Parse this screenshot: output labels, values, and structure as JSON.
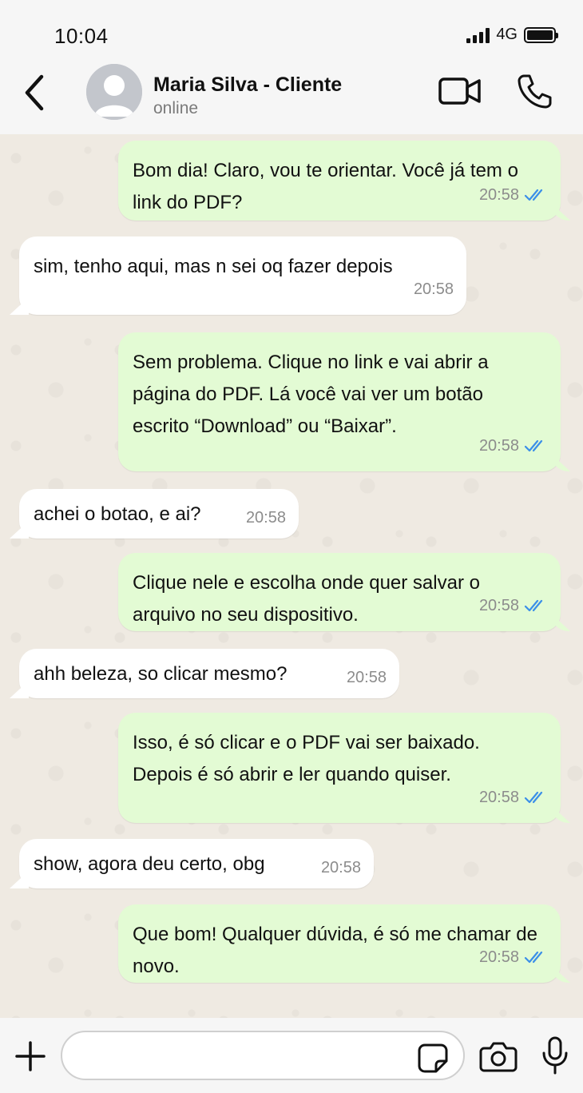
{
  "status_bar": {
    "time": "10:04",
    "network": "4G",
    "battery_level": 1.0
  },
  "header": {
    "contact_name": "Maria Silva - Cliente",
    "contact_status": "online"
  },
  "colors": {
    "outgoing_bubble": "#e3fbd4",
    "incoming_bubble": "#ffffff",
    "read_ticks": "#3b8fe8",
    "chat_background": "#efeae2"
  },
  "messages": [
    {
      "direction": "outgoing",
      "text": "Bom dia! Claro, vou te orientar. Você já tem o link do PDF?",
      "time": "20:58",
      "status": "read"
    },
    {
      "direction": "incoming",
      "text": "sim, tenho aqui, mas n sei oq fazer depois",
      "time": "20:58"
    },
    {
      "direction": "outgoing",
      "text": "Sem problema. Clique no link e vai abrir a página do PDF. Lá você vai ver um botão escrito “Download” ou “Baixar”.",
      "time": "20:58",
      "status": "read"
    },
    {
      "direction": "incoming",
      "text": "achei o botao, e ai?",
      "time": "20:58"
    },
    {
      "direction": "outgoing",
      "text": "Clique nele e escolha onde quer salvar o arquivo no seu dispositivo.",
      "time": "20:58",
      "status": "read"
    },
    {
      "direction": "incoming",
      "text": "ahh beleza, so clicar mesmo?",
      "time": "20:58"
    },
    {
      "direction": "outgoing",
      "text": "Isso, é só clicar e o PDF vai ser baixado. Depois é só abrir e ler quando quiser.",
      "time": "20:58",
      "status": "read"
    },
    {
      "direction": "incoming",
      "text": "show, agora deu certo, obg",
      "time": "20:58"
    },
    {
      "direction": "outgoing",
      "text": "Que bom! Qualquer dúvida, é só me chamar de novo.",
      "time": "20:58",
      "status": "read"
    }
  ],
  "input_bar": {
    "value": "",
    "icons": [
      "plus-icon",
      "sticker-icon",
      "camera-icon",
      "microphone-icon"
    ]
  }
}
